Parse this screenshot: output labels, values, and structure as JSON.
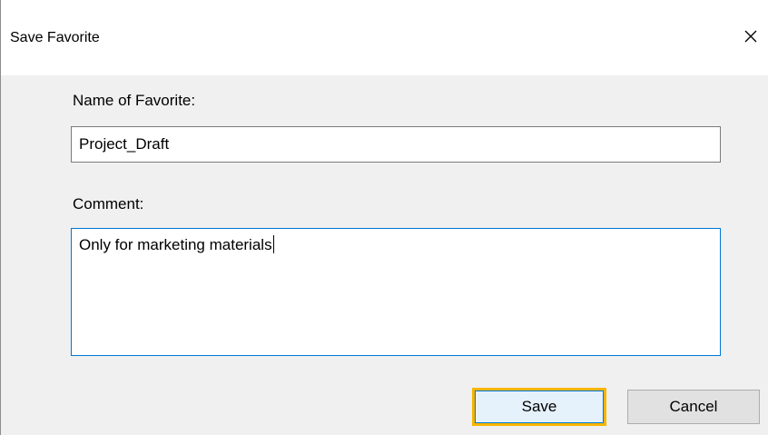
{
  "dialog": {
    "title": "Save Favorite",
    "close_icon": "close-icon"
  },
  "form": {
    "name_label": "Name of Favorite:",
    "name_value": "Project_Draft",
    "comment_label": "Comment:",
    "comment_value": "Only for marketing materials"
  },
  "buttons": {
    "save_label": "Save",
    "cancel_label": "Cancel"
  },
  "colors": {
    "focus_border": "#0078d7",
    "highlight_outline": "#f7b500",
    "dialog_background": "#f0f0f0"
  }
}
